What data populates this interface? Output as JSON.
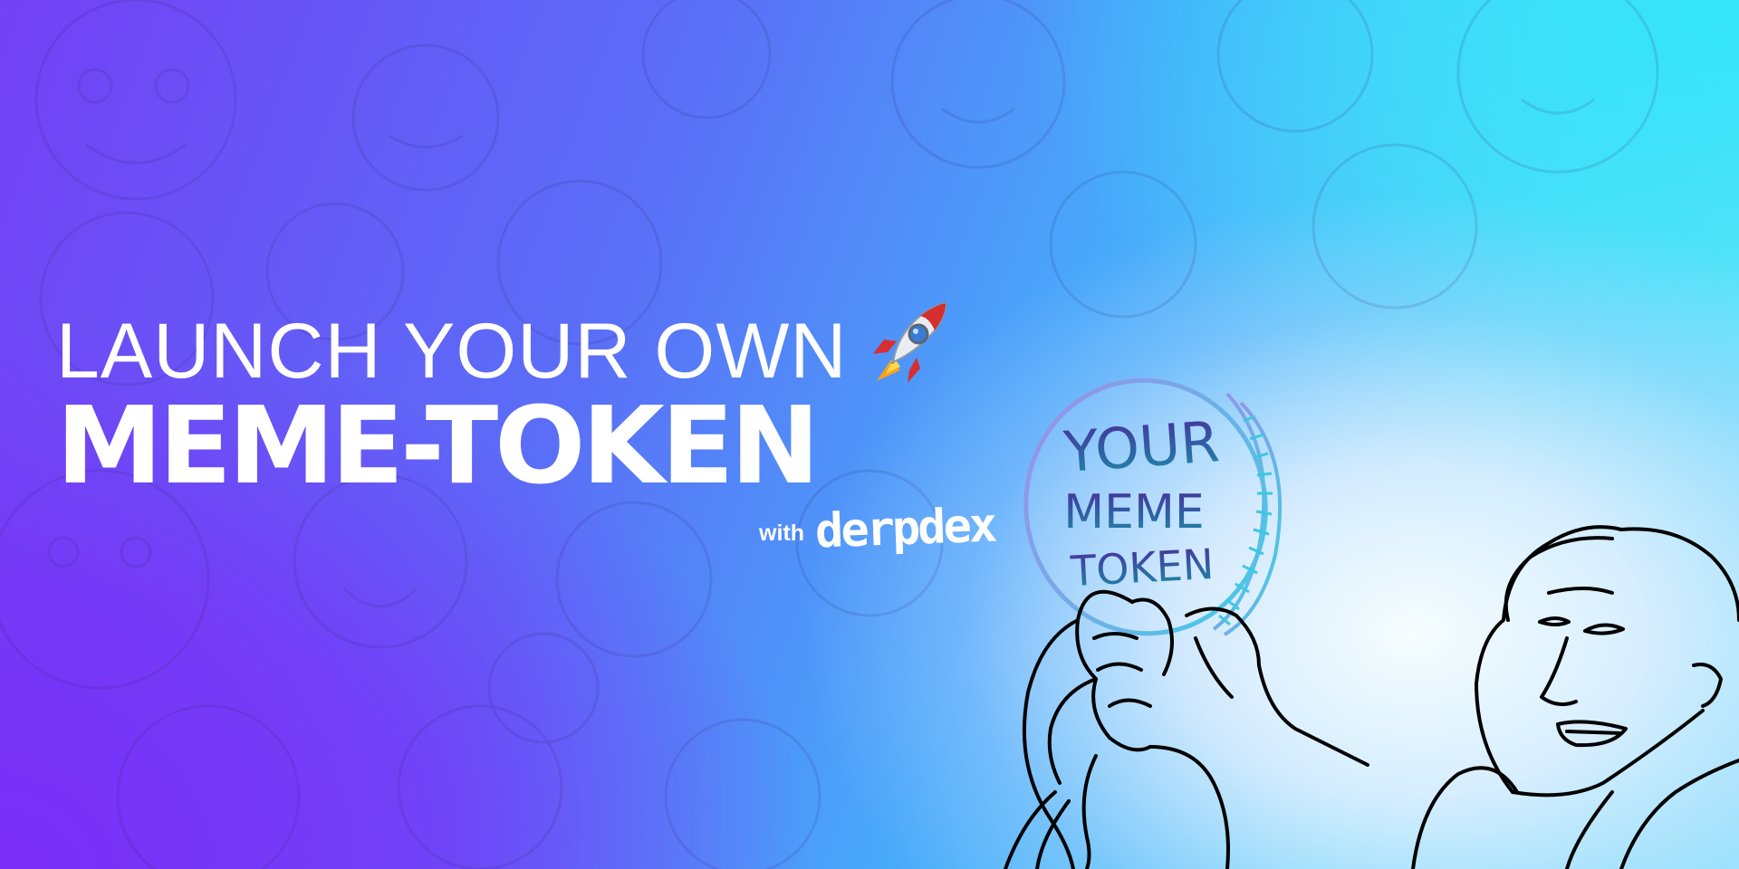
{
  "headline": {
    "line1": "LAUNCH YOUR OWN",
    "line2": "MEME-TOKEN"
  },
  "byline": {
    "with": "with",
    "brand": "derpdex"
  },
  "coin": {
    "text_line1": "YOUR",
    "text_line2": "MEME",
    "text_line3": "TOKEN"
  },
  "icons": {
    "rocket": "rocket-icon"
  },
  "colors": {
    "gradient_left": "#7a2ff7",
    "gradient_top_right": "#34e4f9",
    "headline_text": "#ffffff",
    "coin_text_top": "#4b2b9c",
    "coin_text_bottom": "#1a8fa8",
    "sketch_lines": "#000000"
  }
}
